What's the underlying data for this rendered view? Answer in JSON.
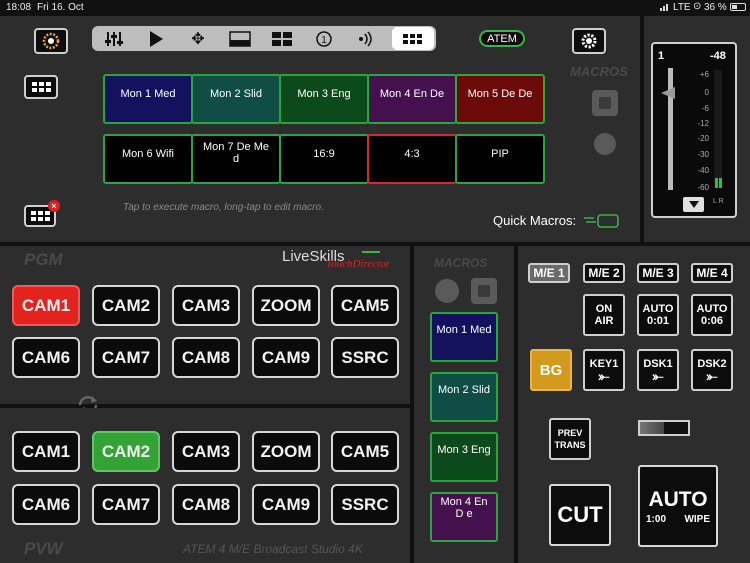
{
  "status_bar": {
    "time": "18:08",
    "date": "Fri 16. Oct",
    "network": "LTE",
    "battery": "36 %"
  },
  "top": {
    "atem_label": "ATEM",
    "macros_label": "MACROS",
    "hint": "Tap to execute macro, long-tap to edit macro.",
    "quick_macros_label": "Quick Macros:",
    "macros": [
      "Mon 1 Med",
      "Mon 2 Slid",
      "Mon 3 Eng",
      "Mon 4 En De",
      "Mon 5 De De",
      "Mon 6 Wifi",
      "Mon 7 De Me d",
      "16:9",
      "4:3",
      "PIP"
    ],
    "toolbar_icons": [
      "mixer-icon",
      "play-icon",
      "move-icon",
      "lower-third-icon",
      "multiview-icon",
      "one-icon",
      "audio-icon",
      "grid-icon"
    ]
  },
  "audio": {
    "channel": "1",
    "level": "-48",
    "scale": [
      "+6",
      "0",
      "-6",
      "-12",
      "-20",
      "-30",
      "-40",
      "-60"
    ],
    "lr": "L R"
  },
  "pgm": {
    "label": "PGM",
    "brand": "LiveSkills",
    "brand_sub": "TouchDirector",
    "row1": [
      "CAM1",
      "CAM2",
      "CAM3",
      "ZOOM",
      "CAM5"
    ],
    "row2": [
      "CAM6",
      "CAM7",
      "CAM8",
      "CAM9",
      "SSRC"
    ]
  },
  "pvw": {
    "label": "PVW",
    "model": "ATEM 4 M/E Broadcast Studio 4K",
    "row1": [
      "CAM1",
      "CAM2",
      "CAM3",
      "ZOOM",
      "CAM5"
    ],
    "row2": [
      "CAM6",
      "CAM7",
      "CAM8",
      "CAM9",
      "SSRC"
    ]
  },
  "side_macros": {
    "label": "MACROS",
    "items": [
      "Mon 1 Med",
      "Mon 2 Slid",
      "Mon 3 Eng",
      "Mon 4 En D e"
    ]
  },
  "transition": {
    "me_buttons": [
      "M/E 1",
      "M/E 2",
      "M/E 3",
      "M/E 4"
    ],
    "on_air": "ON AIR",
    "auto1": {
      "label": "AUTO",
      "time": "0:01"
    },
    "auto2": {
      "label": "AUTO",
      "time": "0:06"
    },
    "bg": "BG",
    "key1": "KEY1",
    "dsk1": "DSK1",
    "dsk2": "DSK2",
    "prev_trans": "PREV TRANS",
    "cut": "CUT",
    "auto_big": {
      "label": "AUTO",
      "time": "1:00",
      "type": "WIPE"
    }
  },
  "colors": {
    "pgm_selected": "#e4231f",
    "pvw_selected": "#33a336",
    "bg_button": "#d49a1e",
    "macro_border": "#2aa43f"
  }
}
